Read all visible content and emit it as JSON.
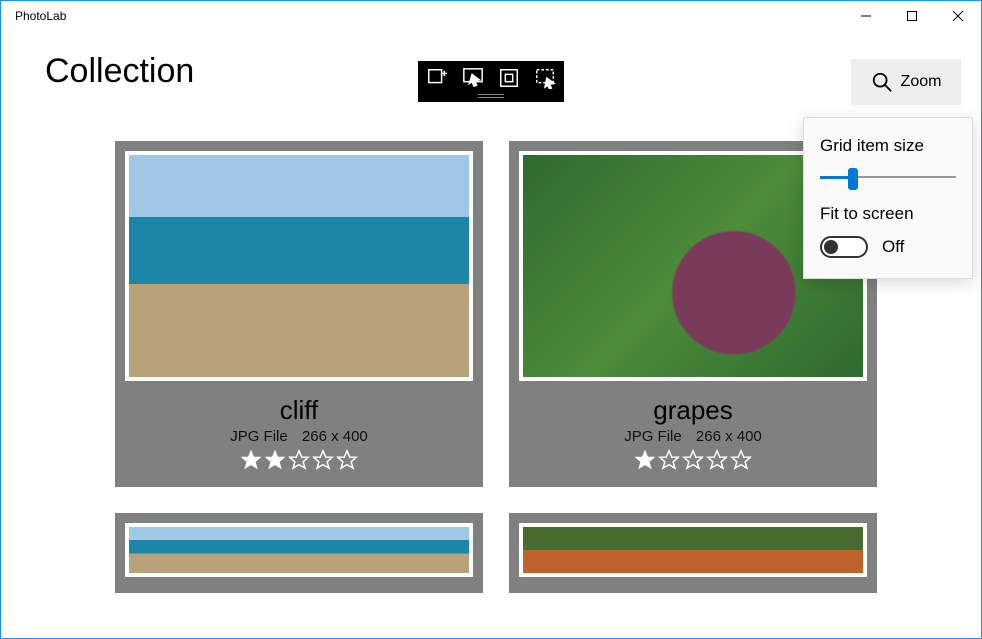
{
  "window": {
    "title": "PhotoLab"
  },
  "page": {
    "title": "Collection"
  },
  "zoom": {
    "button_label": "Zoom",
    "popup": {
      "size_label": "Grid item size",
      "fit_label": "Fit to screen",
      "fit_state": "Off",
      "slider_value_pct": 24
    }
  },
  "items": [
    {
      "name": "cliff",
      "file_type": "JPG File",
      "dimensions": "266 x 400",
      "rating": 2
    },
    {
      "name": "grapes",
      "file_type": "JPG File",
      "dimensions": "266 x 400",
      "rating": 1
    }
  ]
}
